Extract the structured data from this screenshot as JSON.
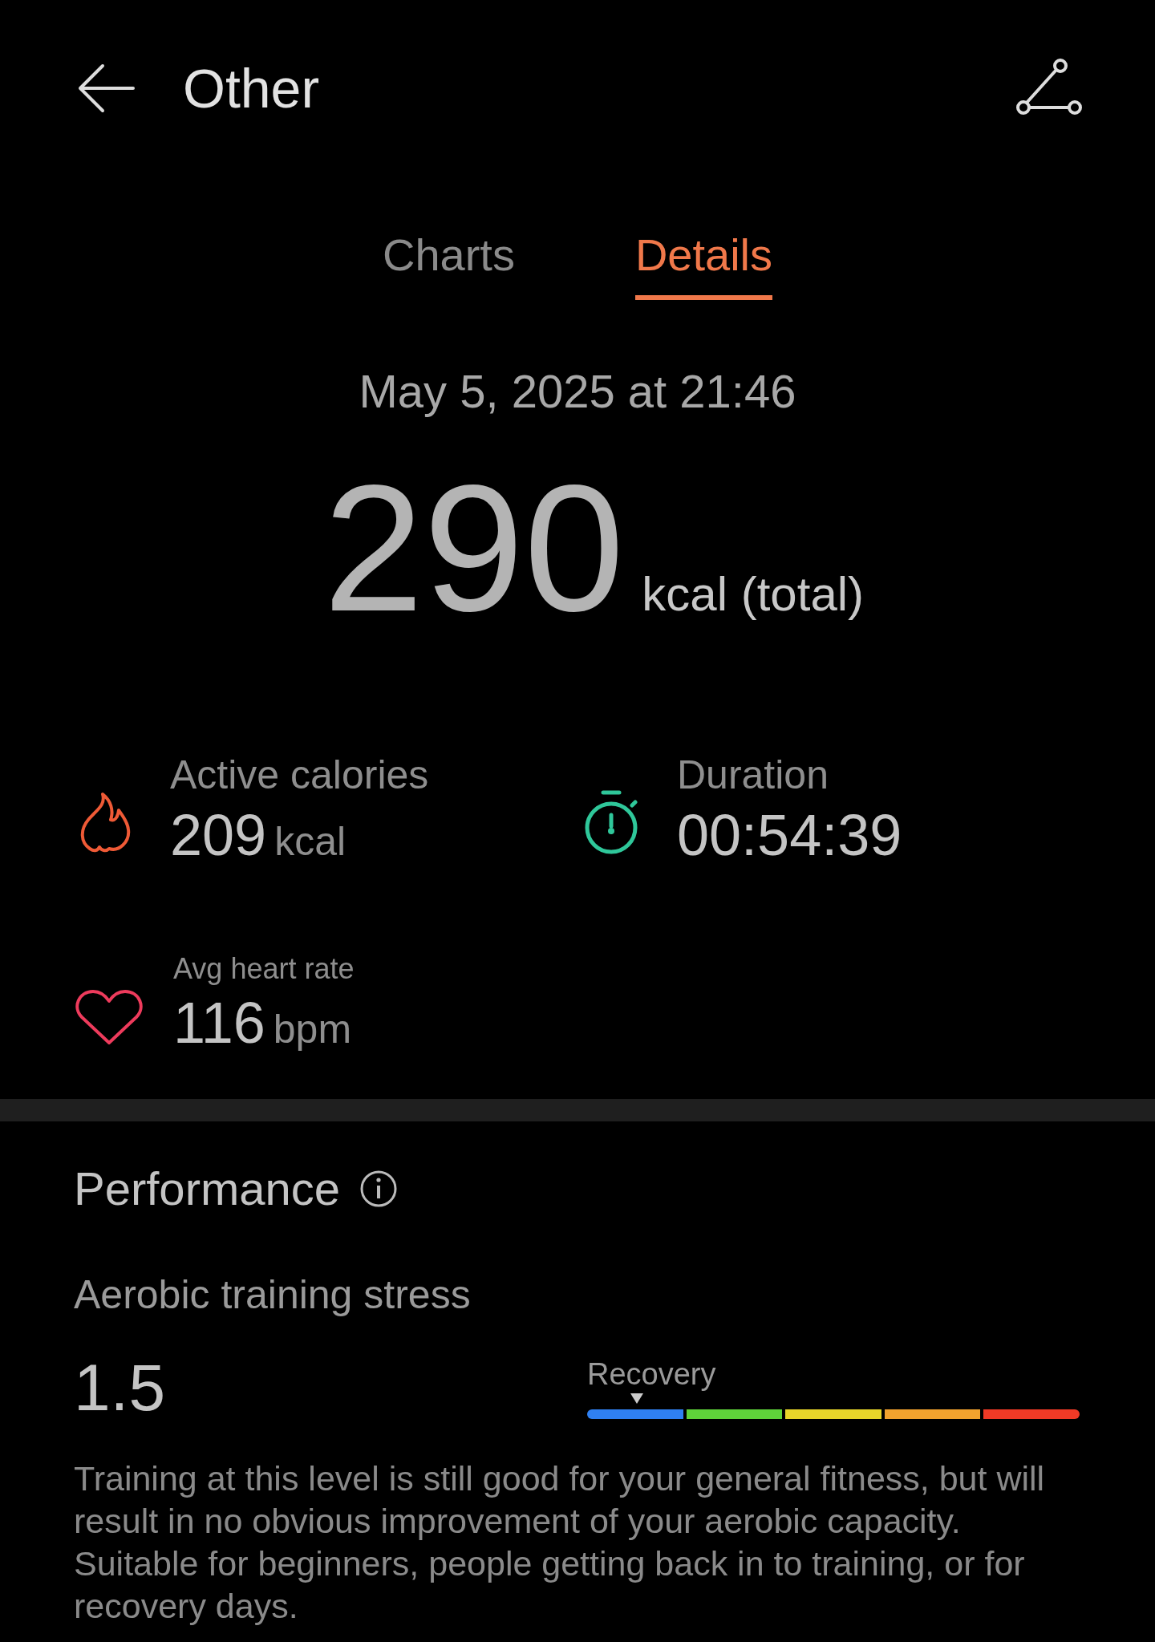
{
  "header": {
    "title": "Other"
  },
  "tabs": [
    {
      "label": "Charts",
      "selected": false
    },
    {
      "label": "Details",
      "selected": true
    }
  ],
  "summary": {
    "date": "May 5, 2025 at 21:46",
    "total": "290",
    "total_unit": "kcal (total)"
  },
  "stats": [
    {
      "kind": "calories",
      "label": "Active calories",
      "value": "209",
      "unit": "kcal"
    },
    {
      "kind": "duration",
      "label": "Duration",
      "value": "00:54:39"
    },
    {
      "kind": "heart",
      "label": "Avg heart rate",
      "value": "116",
      "unit": "bpm"
    }
  ],
  "performance": {
    "title": "Performance",
    "metric": "Aerobic training stress",
    "value": "1.5",
    "scale": {
      "label": "Recovery",
      "segments": [
        {
          "color": "#2f80f2"
        },
        {
          "color": "#5fd33a"
        },
        {
          "color": "#e8d62a"
        },
        {
          "color": "#f2a22e"
        },
        {
          "color": "#f03a26"
        }
      ]
    },
    "description": "Training at this level is still good for your general fitness, but will result in no obvious improvement of your aerobic capacity. Suitable for beginners, people getting back in to training, or for recovery days."
  }
}
